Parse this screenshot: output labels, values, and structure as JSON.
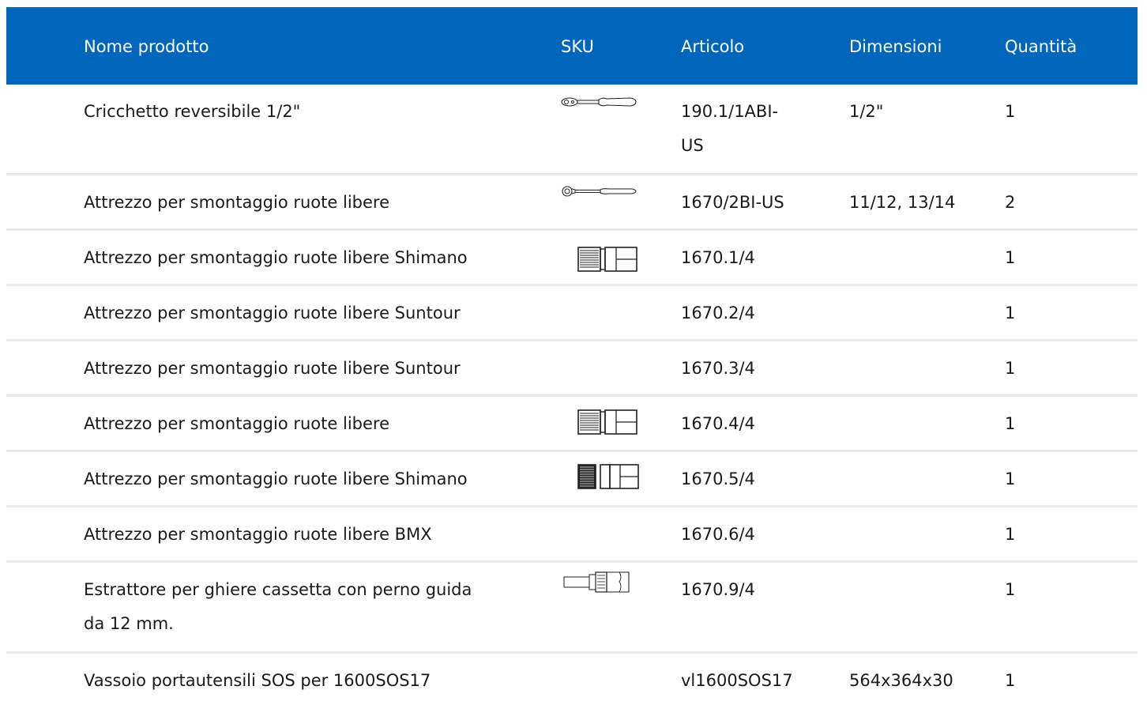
{
  "header": {
    "name": "Nome prodotto",
    "sku": "SKU",
    "article": "Articolo",
    "dimensions": "Dimensioni",
    "quantity": "Quantità"
  },
  "colors": {
    "header_bg": "#0066bb",
    "header_text": "#ffffff",
    "divider": "#e9e9e9"
  },
  "rows": [
    {
      "name": "Cricchetto reversibile 1/2\"",
      "sku_icon": "ratchet-icon",
      "article": "190.1/1ABI-US",
      "dimensions": "1/2\"",
      "quantity": "1"
    },
    {
      "name": "Attrezzo per smontaggio ruote libere",
      "sku_icon": "ratchet-icon",
      "article": "1670/2BI-US",
      "dimensions": "11/12, 13/14",
      "quantity": "2"
    },
    {
      "name": "Attrezzo per smontaggio ruote libere Shimano",
      "sku_icon": "freewheel-socket-icon",
      "article": "1670.1/4",
      "dimensions": "",
      "quantity": "1"
    },
    {
      "name": "Attrezzo per smontaggio ruote libere Suntour",
      "sku_icon": "",
      "article": "1670.2/4",
      "dimensions": "",
      "quantity": "1"
    },
    {
      "name": "Attrezzo per smontaggio ruote libere Suntour",
      "sku_icon": "",
      "article": "1670.3/4",
      "dimensions": "",
      "quantity": "1"
    },
    {
      "name": "Attrezzo per smontaggio ruote libere",
      "sku_icon": "freewheel-socket-icon",
      "article": "1670.4/4",
      "dimensions": "",
      "quantity": "1"
    },
    {
      "name": "Attrezzo per smontaggio ruote libere Shimano",
      "sku_icon": "freewheel-socket-dense-icon",
      "article": "1670.5/4",
      "dimensions": "",
      "quantity": "1"
    },
    {
      "name": "Attrezzo per smontaggio ruote libere BMX",
      "sku_icon": "",
      "article": "1670.6/4",
      "dimensions": "",
      "quantity": "1"
    },
    {
      "name": "Estrattore per ghiere cassetta con perno guida da 12 mm.",
      "sku_icon": "cassette-extractor-icon",
      "article": "1670.9/4",
      "dimensions": "",
      "quantity": "1"
    },
    {
      "name": "Vassoio portautensili SOS per 1600SOS17",
      "sku_icon": "",
      "article": "vl1600SOS17",
      "dimensions": "564x364x30",
      "quantity": "1"
    }
  ]
}
